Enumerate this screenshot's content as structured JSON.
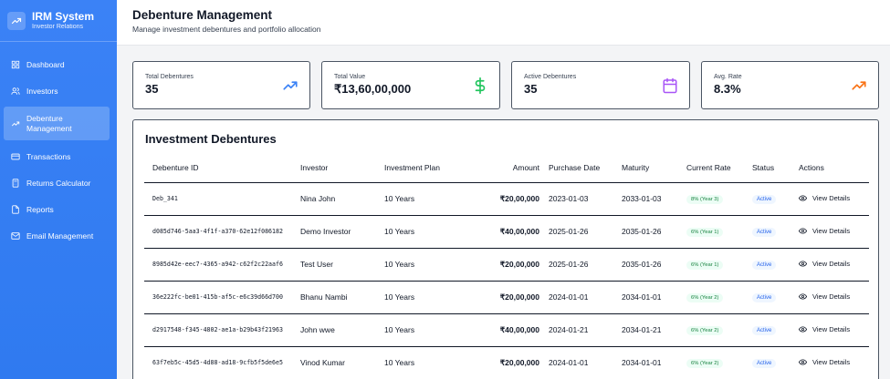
{
  "app": {
    "title": "IRM System",
    "subtitle": "Investor Relations"
  },
  "sidebar": {
    "items": [
      {
        "label": "Dashboard",
        "icon": "grid-icon",
        "active": false
      },
      {
        "label": "Investors",
        "icon": "users-icon",
        "active": false
      },
      {
        "label": "Debenture Management",
        "icon": "trending-up-icon",
        "active": true
      },
      {
        "label": "Transactions",
        "icon": "credit-card-icon",
        "active": false
      },
      {
        "label": "Returns Calculator",
        "icon": "calculator-icon",
        "active": false
      },
      {
        "label": "Reports",
        "icon": "document-icon",
        "active": false
      },
      {
        "label": "Email Management",
        "icon": "mail-icon",
        "active": false
      }
    ]
  },
  "header": {
    "title": "Debenture Management",
    "subtitle": "Manage investment debentures and portfolio allocation"
  },
  "stats": [
    {
      "label": "Total Debentures",
      "value": "35",
      "icon": "trending-up-icon",
      "color": "#3b82f6"
    },
    {
      "label": "Total Value",
      "value": "₹13,60,00,000",
      "icon": "dollar-icon",
      "color": "#22c55e"
    },
    {
      "label": "Active Debentures",
      "value": "35",
      "icon": "calendar-icon",
      "color": "#a855f7"
    },
    {
      "label": "Avg. Rate",
      "value": "8.3%",
      "icon": "trending-up-icon",
      "color": "#f97316"
    }
  ],
  "table": {
    "title": "Investment Debentures",
    "columns": [
      "Debenture ID",
      "Investor",
      "Investment Plan",
      "Amount",
      "Purchase Date",
      "Maturity",
      "Current Rate",
      "Status",
      "Actions"
    ],
    "action_label": "View Details",
    "rows": [
      {
        "id": "Deb_341",
        "investor": "Nina John",
        "plan": "10 Years",
        "amount": "₹20,00,000",
        "purchase": "2023-01-03",
        "maturity": "2033-01-03",
        "rate": "8% (Year 3)",
        "status": "Active"
      },
      {
        "id": "d085d746-5aa3-4f1f-a370-62e12f086182",
        "investor": "Demo Investor",
        "plan": "10 Years",
        "amount": "₹40,00,000",
        "purchase": "2025-01-26",
        "maturity": "2035-01-26",
        "rate": "6% (Year 1)",
        "status": "Active"
      },
      {
        "id": "8985d42e-eec7-4365-a942-c62f2c22aaf6",
        "investor": "Test User",
        "plan": "10 Years",
        "amount": "₹20,00,000",
        "purchase": "2025-01-26",
        "maturity": "2035-01-26",
        "rate": "6% (Year 1)",
        "status": "Active"
      },
      {
        "id": "36e222fc-be01-415b-af5c-e6c39d66d700",
        "investor": "Bhanu Nambi",
        "plan": "10 Years",
        "amount": "₹20,00,000",
        "purchase": "2024-01-01",
        "maturity": "2034-01-01",
        "rate": "6% (Year 2)",
        "status": "Active"
      },
      {
        "id": "d2917548-f345-4802-ae1a-b29b43f21963",
        "investor": "John wwe",
        "plan": "10 Years",
        "amount": "₹40,00,000",
        "purchase": "2024-01-21",
        "maturity": "2034-01-21",
        "rate": "6% (Year 2)",
        "status": "Active"
      },
      {
        "id": "63f7eb5c-45d5-4d88-ad18-9cfb5f5de6e5",
        "investor": "Vinod Kumar",
        "plan": "10 Years",
        "amount": "₹20,00,000",
        "purchase": "2024-01-01",
        "maturity": "2034-01-01",
        "rate": "6% (Year 2)",
        "status": "Active"
      }
    ]
  }
}
